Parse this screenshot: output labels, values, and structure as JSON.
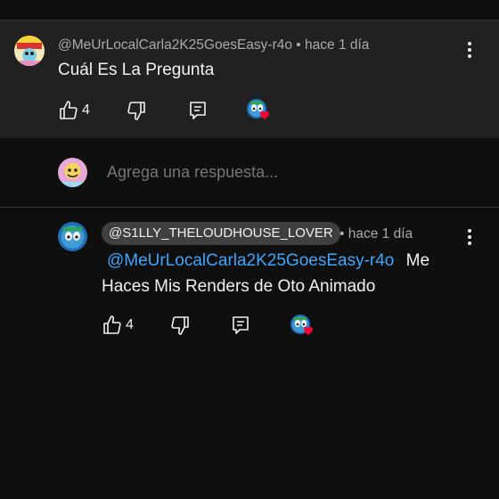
{
  "comment": {
    "author_line": "@MeUrLocalCarla2K25GoesEasy-r4o • hace 1 día",
    "text": "Cuál Es La Pregunta",
    "like_count": "4"
  },
  "reply_box": {
    "placeholder": "Agrega una respuesta..."
  },
  "reply": {
    "author_handle": "@S1LLY_THELOUDHOUSE_LOVER",
    "time": "• hace 1 día",
    "mention": "@MeUrLocalCarla2K25GoesEasy-r4o",
    "text_line1_tail": "Me",
    "text_line2": "Haces Mis Renders de Oto Animado",
    "like_count": "4"
  },
  "icons": {
    "like": "thumbs-up-icon",
    "dislike": "thumbs-down-icon",
    "reply": "comment-icon",
    "hearted": "creator-heart-icon",
    "more": "more-vert-icon"
  },
  "colors": {
    "background": "#0f0f0f",
    "highlight_comment": "#212121",
    "mention_link": "#3ea6ff",
    "heart": "#ff0033",
    "secondary_text": "#aaaaaa"
  }
}
